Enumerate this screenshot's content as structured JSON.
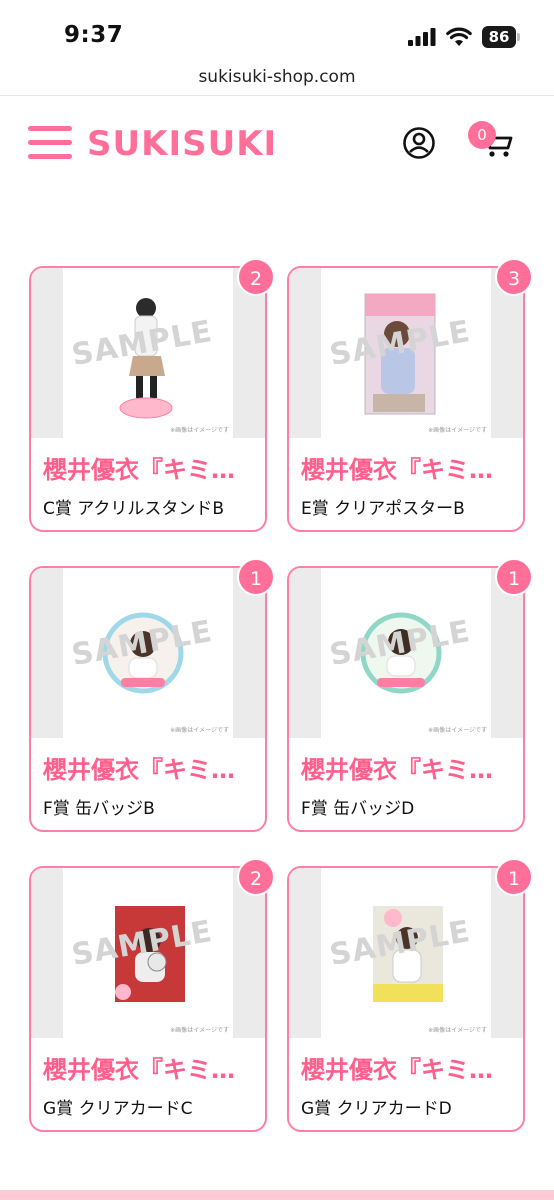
{
  "status_bar": {
    "time": "9:37",
    "battery": "86"
  },
  "browser": {
    "url": "sukisuki-shop.com"
  },
  "header": {
    "logo": "SUKISUKI",
    "cart_count": "0"
  },
  "products": [
    {
      "title": "櫻井優衣『キミ…",
      "subtitle": "C賞 アクリルスタンドB",
      "quantity": "2",
      "watermark": "SAMPLE",
      "image": "acrylic-stand",
      "note": "※画像はイメージです"
    },
    {
      "title": "櫻井優衣『キミ…",
      "subtitle": "E賞 クリアポスターB",
      "quantity": "3",
      "watermark": "SAMPLE",
      "image": "clear-poster",
      "note": "※画像はイメージです"
    },
    {
      "title": "櫻井優衣『キミ…",
      "subtitle": "F賞 缶バッジB",
      "quantity": "1",
      "watermark": "SAMPLE",
      "image": "can-badge",
      "note": "※画像はイメージです"
    },
    {
      "title": "櫻井優衣『キミ…",
      "subtitle": "F賞 缶バッジD",
      "quantity": "1",
      "watermark": "SAMPLE",
      "image": "can-badge",
      "note": "※画像はイメージです"
    },
    {
      "title": "櫻井優衣『キミ…",
      "subtitle": "G賞 クリアカードC",
      "quantity": "2",
      "watermark": "SAMPLE",
      "image": "clear-card",
      "note": "※画像はイメージです"
    },
    {
      "title": "櫻井優衣『キミ…",
      "subtitle": "G賞 クリアカードD",
      "quantity": "1",
      "watermark": "SAMPLE",
      "image": "clear-card",
      "note": "※画像はイメージです"
    }
  ],
  "colors": {
    "accent": "#ff6f9a",
    "border": "#ff7fa4",
    "title": "#ff5f8d"
  }
}
